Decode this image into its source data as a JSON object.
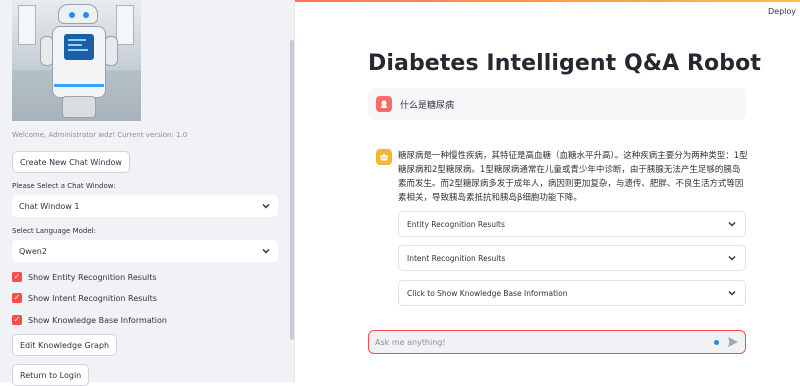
{
  "app": {
    "deploy_label": "Deploy"
  },
  "sidebar": {
    "welcome_text": "Welcome, Administrator wdz! Current version: 1.0",
    "new_chat_button": "Create New Chat Window",
    "chat_select_label": "Please Select a Chat Window:",
    "chat_select_value": "Chat Window 1",
    "model_select_label": "Select Language Model:",
    "model_select_value": "Qwen2",
    "checkboxes": [
      {
        "label": "Show Entity Recognition Results",
        "checked": true
      },
      {
        "label": "Show Intent Recognition Results",
        "checked": true
      },
      {
        "label": "Show Knowledge Base Information",
        "checked": true
      }
    ],
    "edit_graph_button": "Edit Knowledge Graph",
    "return_login_button": "Return to Login"
  },
  "main": {
    "title": "Diabetes Intelligent Q&A Robot",
    "user_message": "什么是糖尿病",
    "bot_message": "糖尿病是一种慢性疾病，其特征是高血糖（血糖水平升高）。这种疾病主要分为两种类型：1型糖尿病和2型糖尿病。1型糖尿病通常在儿童或青少年中诊断，由于胰腺无法产生足够的胰岛素而发生。而2型糖尿病多发于成年人，病因则更加复杂，与遗传、肥胖、不良生活方式等因素相关，导致胰岛素抵抗和胰岛β细胞功能下降。",
    "expanders": [
      "Entity Recognition Results",
      "Intent Recognition Results",
      "Click to Show Knowledge Base Information"
    ],
    "chat_input_placeholder": "Ask me anything!"
  },
  "colors": {
    "accent": "#ff4b4b",
    "user_avatar": "#ff6b6b",
    "bot_avatar": "#f5b731",
    "sidebar_bg": "#f0f2f6"
  },
  "icons": {
    "user_avatar": "user-avatar-icon",
    "bot_avatar": "bot-avatar-icon",
    "send": "send-icon",
    "chevron": "chevron-down-icon"
  }
}
